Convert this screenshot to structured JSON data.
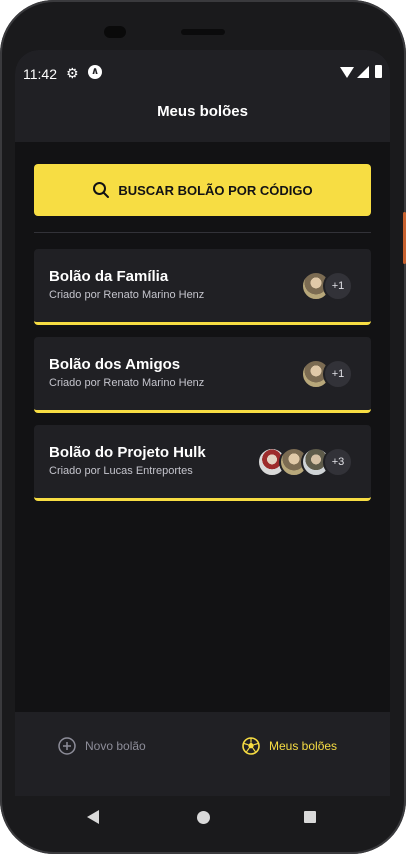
{
  "status_bar": {
    "time": "11:42"
  },
  "header": {
    "title": "Meus bolões"
  },
  "search": {
    "label": "BUSCAR BOLÃO POR CÓDIGO"
  },
  "pools": [
    {
      "title": "Bolão da Família",
      "owner": "Criado por Renato Marino Henz",
      "extra_count": "+1"
    },
    {
      "title": "Bolão dos Amigos",
      "owner": "Criado por Renato Marino Henz",
      "extra_count": "+1"
    },
    {
      "title": "Bolão do Projeto Hulk",
      "owner": "Criado por Lucas Entreportes",
      "extra_count": "+3"
    }
  ],
  "bottom_nav": {
    "new_label": "Novo bolão",
    "mine_label": "Meus bolões",
    "active": "mine"
  },
  "colors": {
    "accent": "#F7DD43",
    "background": "#121214",
    "surface": "#202024",
    "text_muted": "#8d8d99"
  },
  "icons": [
    "settings-gear-icon",
    "android-debug-icon",
    "wifi-icon",
    "signal-icon",
    "battery-icon",
    "search-icon",
    "plus-circle-icon",
    "soccer-ball-icon",
    "back-icon",
    "home-icon",
    "recents-icon"
  ]
}
